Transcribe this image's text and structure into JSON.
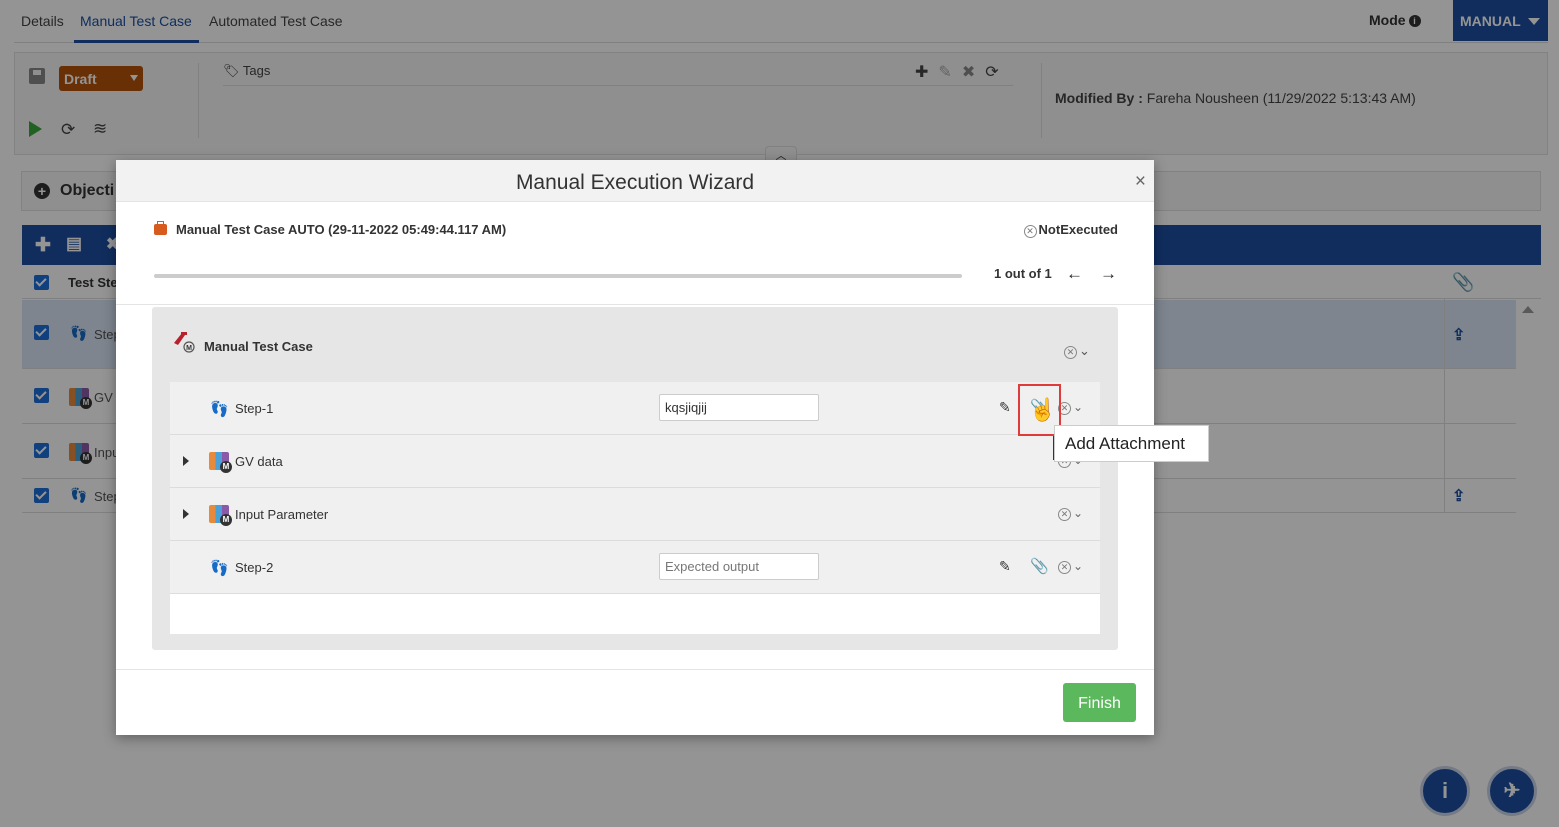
{
  "tabs": [
    {
      "label": "Details"
    },
    {
      "label": "Manual Test Case"
    },
    {
      "label": "Automated Test Case"
    }
  ],
  "mode": {
    "label": "Mode",
    "value": "MANUAL"
  },
  "toolbar": {
    "status": "Draft",
    "tags_label": "Tags",
    "modified_by_label": "Modified By :",
    "modified_by_value": "Fareha Nousheen (11/29/2022 5:13:43 AM)"
  },
  "objectives": {
    "label": "Objecti"
  },
  "steps_table": {
    "header": "Test Ste",
    "rows": [
      {
        "label": "Step"
      },
      {
        "label": "GV"
      },
      {
        "label": "Inpu"
      },
      {
        "label": "Step"
      }
    ]
  },
  "modal": {
    "title": "Manual Execution Wizard",
    "test_case": "Manual Test Case AUTO (29-11-2022 05:49:44.117 AM)",
    "status": "NotExecuted",
    "pager": "1 out of 1",
    "progress_fraction": 0,
    "section_title": "Manual Test Case",
    "steps": [
      {
        "name": "Step-1",
        "value": "kqsjiqjij",
        "placeholder": "Expected output"
      },
      {
        "name": "GV data"
      },
      {
        "name": "Input Parameter"
      },
      {
        "name": "Step-2",
        "value": "",
        "placeholder": "Expected output"
      }
    ],
    "tooltip": "Add Attachment",
    "finish_label": "Finish"
  },
  "colors": {
    "brand": "#1d4fa0",
    "draft": "#b5540c",
    "finish": "#5cb85c",
    "highlight": "#e03b3b"
  },
  "icons": [
    "save-icon",
    "play-icon",
    "refresh-icon",
    "layers-icon",
    "tag-icon",
    "plus-icon",
    "edit-icon",
    "close-icon",
    "paperclip-icon",
    "upload-icon",
    "briefcase-icon",
    "arrow-left-icon",
    "arrow-right-icon",
    "footsteps-icon",
    "hand-cursor-icon",
    "info-icon",
    "plane-icon"
  ]
}
